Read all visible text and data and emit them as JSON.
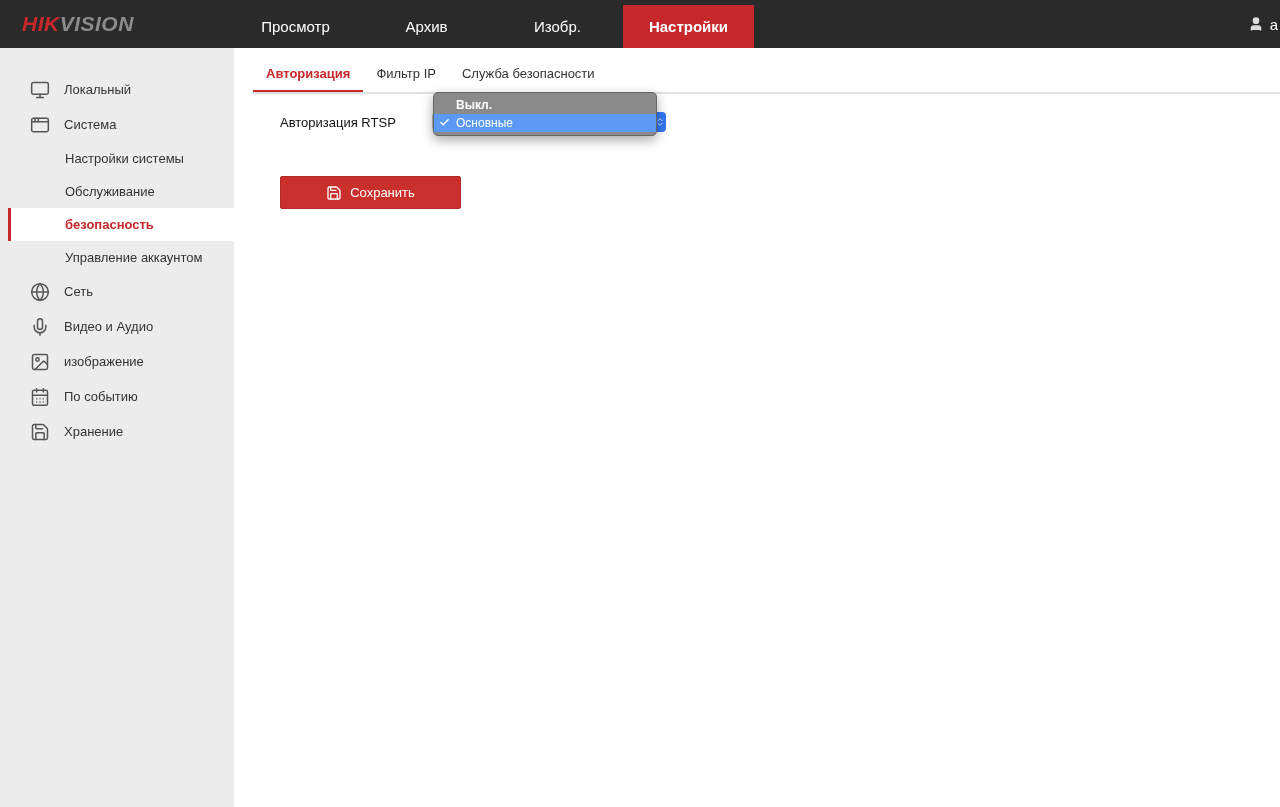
{
  "header": {
    "logo": {
      "accent": "HIK",
      "rest": "VISION"
    },
    "user": "a",
    "nav": [
      {
        "label": "Просмотр",
        "selected": false
      },
      {
        "label": "Архив",
        "selected": false
      },
      {
        "label": "Изобр.",
        "selected": false
      },
      {
        "label": "Настройки",
        "selected": true
      }
    ]
  },
  "sidebar": {
    "items": [
      {
        "label": "Локальный",
        "selected": false
      },
      {
        "label": "Система",
        "selected": false,
        "children": [
          {
            "label": "Настройки системы",
            "selected": false
          },
          {
            "label": "Обслуживание",
            "selected": false
          },
          {
            "label": "безопасность",
            "selected": true
          },
          {
            "label": "Управление аккаунтом",
            "selected": false
          }
        ]
      },
      {
        "label": "Сеть",
        "selected": false
      },
      {
        "label": "Видео и Аудио",
        "selected": false
      },
      {
        "label": "изображение",
        "selected": false
      },
      {
        "label": "По событию",
        "selected": false
      },
      {
        "label": "Хранение",
        "selected": false
      }
    ]
  },
  "tabs": [
    {
      "label": "Авторизация",
      "selected": true
    },
    {
      "label": "Фильтр IP",
      "selected": false
    },
    {
      "label": "Служба безопасности",
      "selected": false
    }
  ],
  "form": {
    "label": "Авторизация RTSP",
    "options": [
      {
        "label": "Выкл.",
        "selected": false
      },
      {
        "label": "Основные",
        "selected": true
      }
    ]
  },
  "save_button": "Сохранить"
}
